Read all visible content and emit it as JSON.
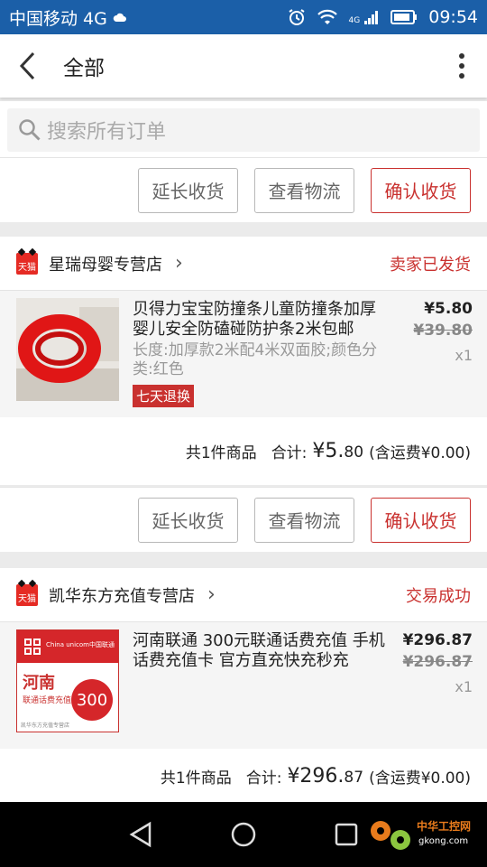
{
  "status": {
    "carrier": "中国移动 4G",
    "time": "09:54",
    "net_label": "4G"
  },
  "header": {
    "title": "全部"
  },
  "search": {
    "placeholder": "搜索所有订单"
  },
  "buttons": {
    "extend": "延长收货",
    "logistics": "查看物流",
    "confirm": "确认收货"
  },
  "orders": [
    {
      "shop": "星瑞母婴专营店",
      "status": "卖家已发货",
      "badge": "天猫",
      "item_title": "贝得力宝宝防撞条儿童防撞条加厚婴儿安全防磕碰防护条2米包邮",
      "item_spec": "长度:加厚款2米配4米双面胶;颜色分类:红色",
      "tag": "七天退换",
      "price": "¥5.80",
      "old_price": "¥39.80",
      "qty": "x1",
      "count_text": "共1件商品",
      "total_label": "合计:",
      "total_main": "¥5.",
      "total_decimal": "80",
      "shipping": "(含运费¥0.00)"
    },
    {
      "shop": "凯华东方充值专营店",
      "status": "交易成功",
      "badge": "天猫",
      "item_title": "河南联通 300元联通话费充值 手机话费充值卡 官方直充快充秒充",
      "price": "¥296.87",
      "old_price": "¥296.87",
      "qty": "x1",
      "count_text": "共1件商品",
      "total_label": "合计:",
      "total_main": "¥296.",
      "total_decimal": "87",
      "shipping": "(含运费¥0.00)",
      "thumb": {
        "brand": "China unicom中国联通",
        "province": "河南",
        "sub": "联通话费充值",
        "amount": "300",
        "footer": "凯华东方充值专营店"
      }
    }
  ],
  "watermark": {
    "text": "中华工控网",
    "url": "gkong.com"
  },
  "colors": {
    "statusbar": "#1b5fa8",
    "accent": "#c9312f",
    "background": "#ebebeb"
  }
}
